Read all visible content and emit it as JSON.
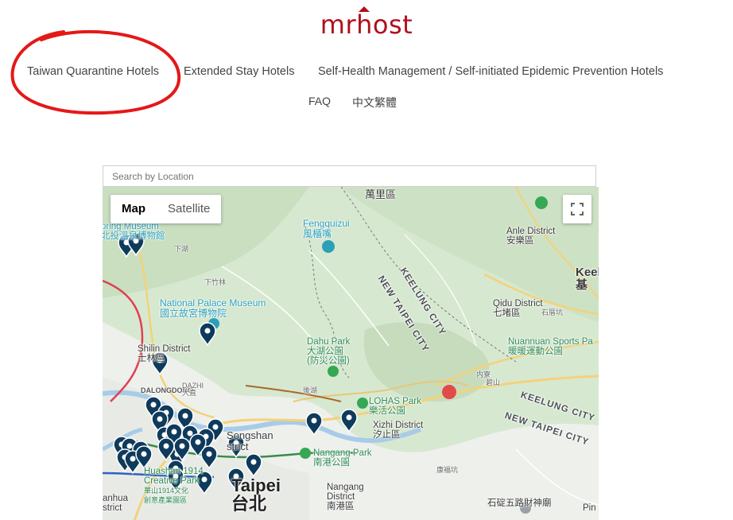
{
  "brand": {
    "logo_text": "mrhost"
  },
  "nav": {
    "items": [
      {
        "label": "Taiwan Quarantine Hotels"
      },
      {
        "label": "Extended Stay Hotels"
      },
      {
        "label": "Self-Health Management / Self-initiated Epidemic Prevention Hotels"
      },
      {
        "label": "FAQ"
      },
      {
        "label": "中文繁體"
      }
    ]
  },
  "colors": {
    "brand": "#b10f1e",
    "annotation_circle": "#e51818",
    "marker": "#0e3a5c"
  },
  "map": {
    "search_placeholder": "Search by Location",
    "maptype": {
      "map": "Map",
      "satellite": "Satellite"
    },
    "fullscreen_icon": "fullscreen-icon",
    "labels": {
      "wanli": "萬里區",
      "spring_museum": "pring Museum",
      "spring_museum_zh": "北投溫泉博物館",
      "xiahpo": "下湖",
      "xiachuan": "下竹林",
      "fengquizui": "Fengquizui",
      "fengquizui_zh": "風櫃嘴",
      "anle": "Anle District",
      "anle_zh": "安樂區",
      "keel": "Keel",
      "keel_zh": "基",
      "npm": "National Palace Museum",
      "npm_zh": "國立故宮博物院",
      "keelung_city": "KEELUNG CITY",
      "new_taipei_city": "NEW TAIPEI CITY",
      "qidu": "Qidu District",
      "qidu_zh": "七堵區",
      "shihkang": "石厝坑",
      "nuannuan": "Nuannuan Sports Pa",
      "nuannuan_zh": "暖暖運動公園",
      "shilin": "Shilin District",
      "shilin_zh": "士林區",
      "dahu": "Dahu Park",
      "dahu_zh": "大湖公園",
      "dahu_zh2": "(防災公園)",
      "dalongdong": "DALONGDONG",
      "dazhi": "DAZHI",
      "dazhi_zh": "大直",
      "houhu": "後湖",
      "lohas": "LOHAS Park",
      "lohas_zh": "樂活公園",
      "keelung_city2": "KEELUNG CITY",
      "new_taipei_city2": "NEW TAIPEI CITY",
      "songshan": "Songshan",
      "songshan_d": "strict",
      "xizhi": "Xizhi District",
      "xizhi_zh": "汐止區",
      "nangang_park": "Nangang Park",
      "nangang_park_zh": "南港公園",
      "huashan": "Huashan 1914",
      "creative": "Creative Park",
      "creative_zh": "華山1914文化",
      "creative_zh2": "創意產業園區",
      "taipei": "Taipei",
      "taipei_zh": "台北",
      "nangang": "Nangang",
      "nangang_d": "District",
      "nangang_zh": "南港區",
      "wanhua": "anhua",
      "wanhua_d": "strict",
      "shiding": "石碇五路財神廟",
      "pin": "Pin",
      "xinghua": "康福坑",
      "neihu_small": "内寮",
      "neihu_small2": "碧山"
    }
  }
}
